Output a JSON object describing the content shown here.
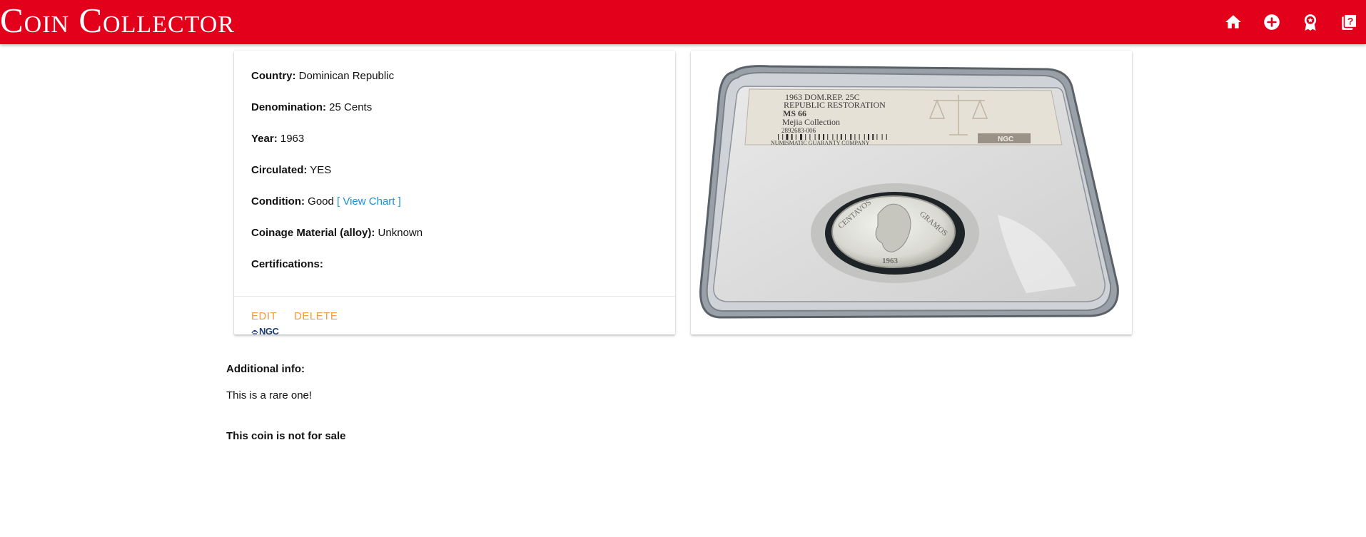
{
  "app": {
    "title": "Coin Collector",
    "accent": "#e2001a",
    "nav_icons": [
      "home-icon",
      "add-circle-icon",
      "award-icon",
      "help-book-icon"
    ]
  },
  "coin": {
    "country_label": "Country:",
    "country": "Dominican Republic",
    "denomination_label": "Denomination:",
    "denomination": "25 Cents",
    "year_label": "Year:",
    "year": "1963",
    "circulated_label": "Circulated:",
    "circulated": "YES",
    "condition_label": "Condition:",
    "condition": "Good",
    "view_chart": "[ View Chart ]",
    "material_label": "Coinage Material (alloy):",
    "material": "Unknown",
    "certifications_label": "Certifications:",
    "certification": "NGC"
  },
  "actions": {
    "edit": "EDIT",
    "delete": "DELETE",
    "color": "#f39a3a"
  },
  "coin_image": {
    "label_lines": [
      "1963 DOM.REP. 25C",
      "REPUBLIC RESTORATION",
      "MS 66",
      "Mejia Collection",
      "2892683-006",
      "NUMISMATIC GUARANTY COMPANY"
    ],
    "label_logo": "NGC",
    "coin_text": [
      "CENTAVOS",
      "GRAMOS",
      "1963"
    ]
  },
  "additional": {
    "label": "Additional info:",
    "text": "This is a rare one!",
    "sale_status": "This coin is not for sale"
  }
}
